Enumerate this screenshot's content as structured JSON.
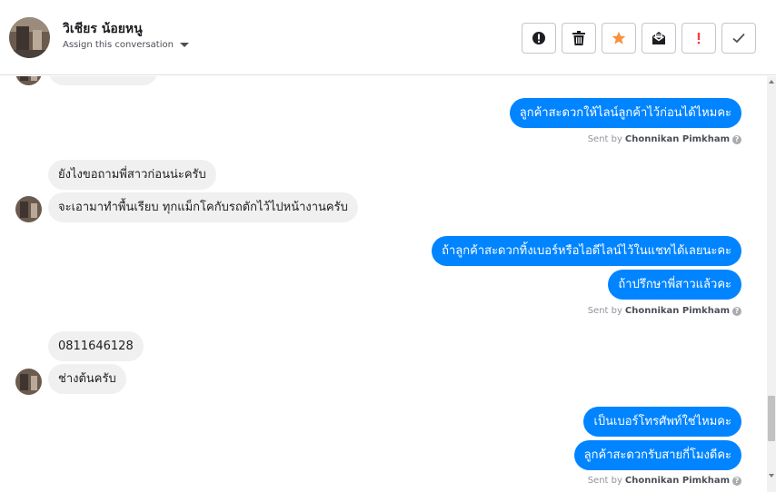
{
  "header": {
    "contact_name": "วิเชียร น้อยหนู",
    "assign_label": "Assign this conversation"
  },
  "actions": [
    {
      "name": "report-spam-button",
      "icon": "alert-circle-icon"
    },
    {
      "name": "delete-button",
      "icon": "trash-icon"
    },
    {
      "name": "star-button",
      "icon": "star-icon",
      "color": "#f7923b"
    },
    {
      "name": "mark-unread-button",
      "icon": "envelope-icon"
    },
    {
      "name": "mark-important-button",
      "icon": "exclamation-icon",
      "color": "#fa3e3e"
    },
    {
      "name": "mark-done-button",
      "icon": "check-icon"
    }
  ],
  "messages": {
    "out1": "ลูกค้าสะดวกให้ไลน์ลูกค้าไว้ก่อนได้ไหมคะ",
    "in1": "ยังไงขอถามพี่สาวก่อนน่ะครับ",
    "in2": "จะเอามาทำพื้นเรียบ ทุกแม็กโคกับรถตักไว้ไปหน้างานครับ",
    "out2": "ถ้าลูกค้าสะดวกทิ้งเบอร์หรือไอดีไลน์ไว้ในแชทได้เลยนะคะ",
    "out3": "ถ้าปรึกษาพี่สาวแล้วคะ",
    "in3": "0811646128",
    "in4": "ช่างต้นครับ",
    "out4": "เป็นเบอร์โทรศัพท์ใช่ไหมคะ",
    "out5": "ลูกค้าสะดวกรับสายกี่โมงดีคะ"
  },
  "sent_by": {
    "prefix": "Sent by",
    "agent": "Chonnikan Pimkham"
  },
  "colors": {
    "outgoing_bubble": "#0084ff",
    "incoming_bubble": "#f1f0f0"
  }
}
